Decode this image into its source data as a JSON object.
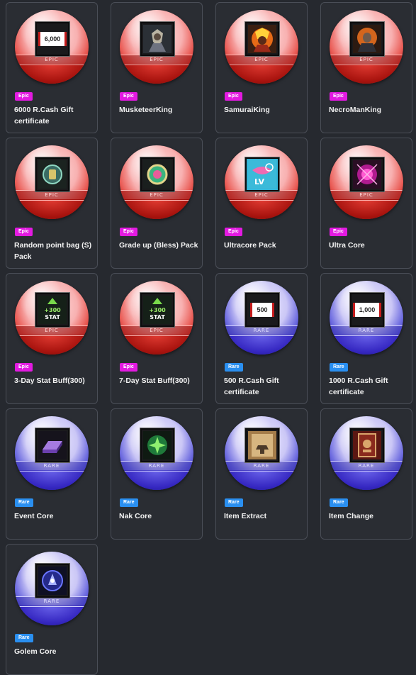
{
  "items": [
    {
      "name": "6000 R.Cash Gift certificate",
      "grade": "Epic",
      "band": "EPIC",
      "icon": "ticket-icon",
      "ticket_value": "6,000"
    },
    {
      "name": "MusketeerKing",
      "grade": "Epic",
      "band": "EPIC",
      "icon": "musketeer-king-portrait-icon"
    },
    {
      "name": "SamuraiKing",
      "grade": "Epic",
      "band": "EPIC",
      "icon": "samurai-king-portrait-icon"
    },
    {
      "name": "NecroManKing",
      "grade": "Epic",
      "band": "EPIC",
      "icon": "necroman-king-portrait-icon"
    },
    {
      "name": "Random point bag (S) Pack",
      "grade": "Epic",
      "band": "EPIC",
      "icon": "point-bag-icon"
    },
    {
      "name": "Grade up (Bless) Pack",
      "grade": "Epic",
      "band": "EPIC",
      "icon": "grade-up-orb-icon"
    },
    {
      "name": "Ultracore Pack",
      "grade": "Epic",
      "band": "EPIC",
      "icon": "ultracore-level-icon",
      "icon_text": "LV"
    },
    {
      "name": "Ultra Core",
      "grade": "Epic",
      "band": "EPIC",
      "icon": "ultra-core-icon"
    },
    {
      "name": "3-Day Stat Buff(300)",
      "grade": "Epic",
      "band": "EPIC",
      "icon": "stat-buff-icon",
      "icon_text": "+300",
      "icon_text2": "STAT"
    },
    {
      "name": "7-Day Stat Buff(300)",
      "grade": "Epic",
      "band": "EPIC",
      "icon": "stat-buff-icon",
      "icon_text": "+300",
      "icon_text2": "STAT"
    },
    {
      "name": "500 R.Cash Gift certificate",
      "grade": "Rare",
      "band": "RARE",
      "icon": "ticket-icon",
      "ticket_value": "500"
    },
    {
      "name": "1000 R.Cash Gift certificate",
      "grade": "Rare",
      "band": "RARE",
      "icon": "ticket-icon",
      "ticket_value": "1,000"
    },
    {
      "name": "Event Core",
      "grade": "Rare",
      "band": "RARE",
      "icon": "purple-ingot-icon"
    },
    {
      "name": "Nak Core",
      "grade": "Rare",
      "band": "RARE",
      "icon": "green-nak-core-icon"
    },
    {
      "name": "Item Extract",
      "grade": "Rare",
      "band": "RARE",
      "icon": "scroll-anvil-icon"
    },
    {
      "name": "Item Change",
      "grade": "Rare",
      "band": "RARE",
      "icon": "item-change-card-icon"
    },
    {
      "name": "Golem Core",
      "grade": "Rare",
      "band": "RARE",
      "icon": "golem-core-icon"
    }
  ],
  "colors": {
    "epic_badge": "#e31ae1",
    "rare_badge": "#2a8ff0",
    "epic_orb": "#c8231f",
    "rare_orb": "#3b34c4",
    "card_border": "#4a4e57",
    "background": "#26292f"
  }
}
